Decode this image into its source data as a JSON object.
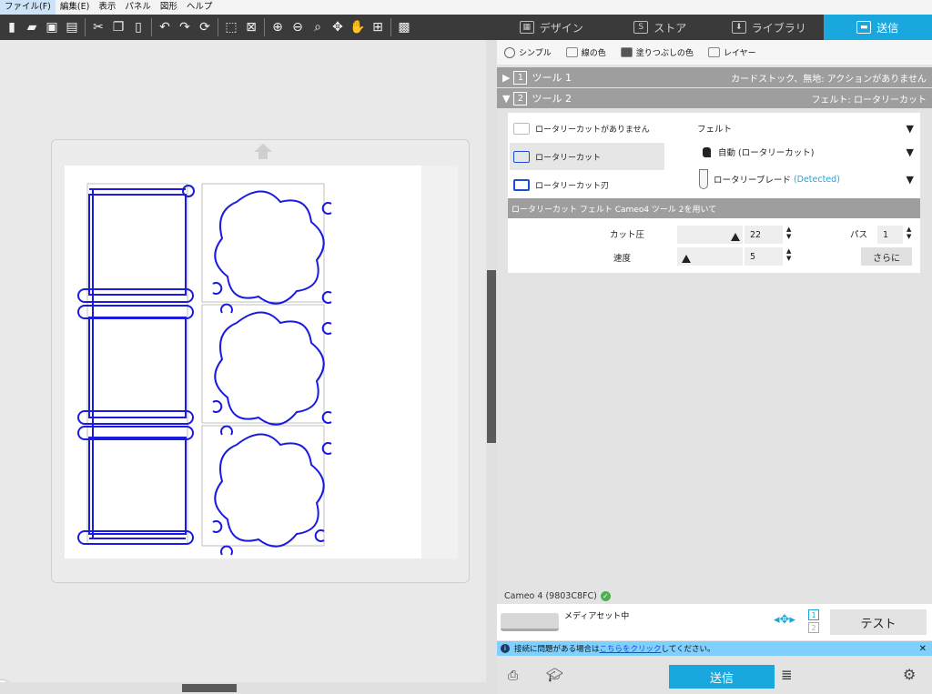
{
  "menu": [
    "ファイル(F)",
    "編集(E)",
    "表示",
    "パネル",
    "図形",
    "ヘルプ"
  ],
  "top_tabs": [
    {
      "label": "デザイン",
      "icon": "grid-icon"
    },
    {
      "label": "ストア",
      "icon": "store-icon"
    },
    {
      "label": "ライブラリ",
      "icon": "library-icon"
    },
    {
      "label": "送信",
      "icon": "send-icon",
      "active": true
    }
  ],
  "sub_tabs": [
    "シンプル",
    "線の色",
    "塗りつぶしの色",
    "レイヤー"
  ],
  "tools": [
    {
      "num": "1",
      "name": "ツール 1",
      "status": "カードストック、無地: アクションがありません"
    },
    {
      "num": "2",
      "name": "ツール 2",
      "status": "フェルト: ロータリーカット"
    }
  ],
  "cut_options": [
    "ロータリーカットがありません",
    "ロータリーカット",
    "ロータリーカット刃"
  ],
  "material": {
    "name": "フェルト",
    "action": "自動 (ロータリーカット)",
    "blade": "ロータリーブレード",
    "detected": "(Detected)"
  },
  "description": "ロータリーカット フェルト Cameo4 ツール 2を用いて",
  "force": {
    "label": "カット圧",
    "value": "22",
    "fraction": 0.95
  },
  "speed": {
    "label": "速度",
    "value": "5",
    "fraction": 0.08
  },
  "passes": {
    "label": "パス",
    "value": "1"
  },
  "more_label": "さらに",
  "device": {
    "name": "Cameo 4 (9803C8FC)",
    "media_status": "メディアセット中",
    "tool_numbers": [
      "1",
      "2"
    ]
  },
  "test_label": "テスト",
  "notice": {
    "prefix": "接続に問題がある場合は",
    "link": "こちらをクリック",
    "suffix": "してください。"
  },
  "send_label": "送信",
  "colors": {
    "accent": "#1aa7de",
    "cut_line": "#1a1ae0",
    "toolbar": "#3a3a3a"
  }
}
